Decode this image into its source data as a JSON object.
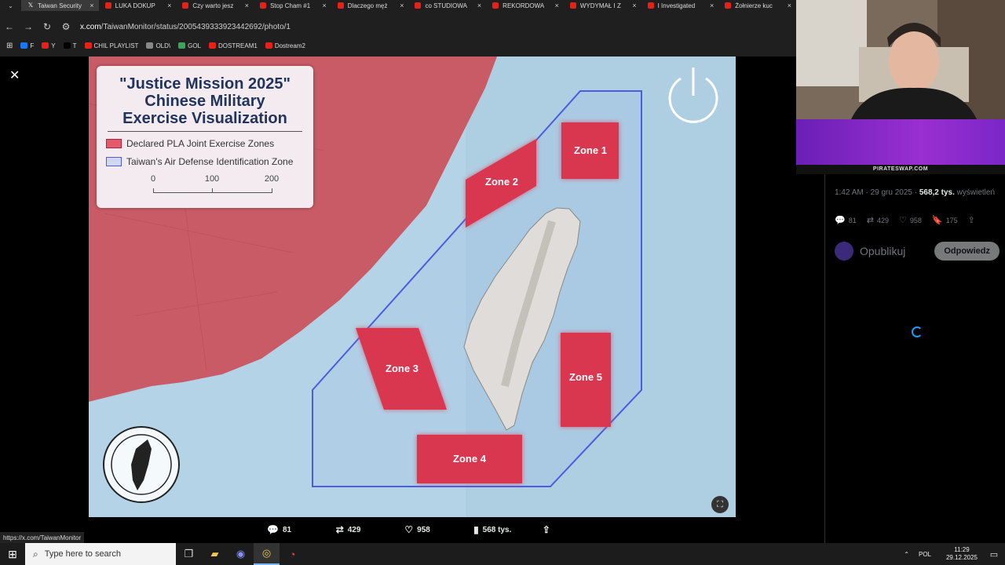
{
  "tabs": [
    {
      "title": "Taiwan Security",
      "icon": "x-icon",
      "active": true
    },
    {
      "title": "LUKA DOKUP",
      "icon": "youtube-icon"
    },
    {
      "title": "Czy warto jesz",
      "icon": "youtube-icon"
    },
    {
      "title": "Stop Cham #1",
      "icon": "youtube-icon"
    },
    {
      "title": "Dlaczego męż",
      "icon": "youtube-icon"
    },
    {
      "title": "co STUDIOWA",
      "icon": "youtube-icon"
    },
    {
      "title": "REKORDOWA",
      "icon": "youtube-icon"
    },
    {
      "title": "WYDYMAŁ I Z",
      "icon": "youtube-icon"
    },
    {
      "title": "I Investigated",
      "icon": "youtube-icon"
    },
    {
      "title": "Żołnierze kuc",
      "icon": "youtube-icon"
    }
  ],
  "address": {
    "host": "x.com",
    "path": "/TaiwanMonitor/status/2005439333923442692/photo/1"
  },
  "bookmarks": [
    "F",
    "Y",
    "T",
    "CHIL PLAYLIST",
    "OLD\\",
    "GOL",
    "DOSTREAM1",
    "Dostream2"
  ],
  "map": {
    "title": "\"Justice Mission 2025\"\nChinese Military\nExercise Visualization",
    "legend": [
      {
        "label": "Declared PLA Joint Exercise Zones",
        "color": "#e25a6c"
      },
      {
        "label": "Taiwan's Air Defense Identification Zone",
        "color": "#4a5de0"
      }
    ],
    "scale_ticks": [
      "0",
      "100",
      "200"
    ],
    "zones": [
      "Zone 1",
      "Zone 2",
      "Zone 3",
      "Zone 4",
      "Zone 5"
    ]
  },
  "actions": {
    "replies": "81",
    "reposts": "429",
    "likes": "958",
    "views": "568 tys."
  },
  "status_url": "https://x.com/TaiwanMonitor",
  "sidebar": {
    "time": "1:42 AM · 29 gru 2025 · ",
    "views_count": "568,2 tys.",
    "views_label": " wyświetleń",
    "stats": {
      "replies": "81",
      "reposts": "429",
      "likes": "958",
      "bookmarks": "175"
    },
    "reply_placeholder": "Opublikuj",
    "reply_button": "Odpowiedz"
  },
  "overlay_label": "PIRATESWAP.COM",
  "taskbar": {
    "search_placeholder": "Type here to search",
    "lang": "POL",
    "time": "11:29",
    "date": "29.12.2025"
  }
}
